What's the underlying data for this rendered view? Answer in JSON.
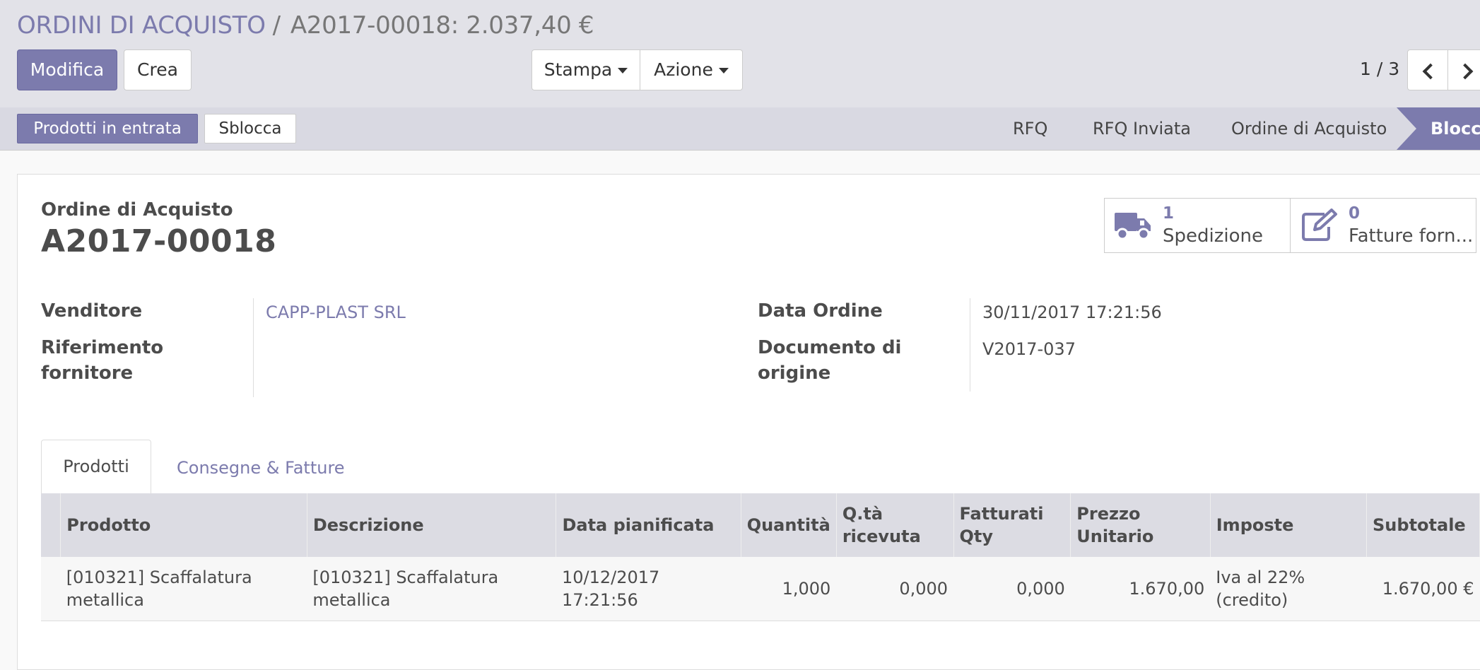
{
  "breadcrumb": {
    "parent": "ORDINI DI ACQUISTO",
    "separator": "/",
    "current": "A2017-00018: 2.037,40 €"
  },
  "toolbar": {
    "edit": "Modifica",
    "create": "Crea",
    "print": "Stampa",
    "action": "Azione"
  },
  "pager": {
    "value": "1 / 3"
  },
  "statusbar": {
    "buttons": {
      "incoming": "Prodotti in entrata",
      "unlock": "Sblocca"
    },
    "stages": [
      "RFQ",
      "RFQ Inviata",
      "Ordine di Acquisto"
    ],
    "active": "Blocca"
  },
  "form": {
    "doc_type": "Ordine di Acquisto",
    "doc_number": "A2017-00018",
    "fields": {
      "vendor_label": "Venditore",
      "vendor_value": "CAPP-PLAST SRL",
      "ref_label_1": "Riferimento",
      "ref_label_2": "fornitore",
      "date_label": "Data Ordine",
      "date_value": "30/11/2017 17:21:56",
      "origin_label_1": "Documento di",
      "origin_label_2": "origine",
      "origin_value": "V2017-037"
    },
    "smart_buttons": [
      {
        "count": "1",
        "label": "Spedizione"
      },
      {
        "count": "0",
        "label": "Fatture forn..."
      }
    ],
    "tabs": [
      "Prodotti",
      "Consegne & Fatture"
    ]
  },
  "table": {
    "headers": [
      [
        "Prodotto"
      ],
      [
        "Descrizione"
      ],
      [
        "Data pianificata"
      ],
      [
        "Quantità"
      ],
      [
        "Q.tà",
        "ricevuta"
      ],
      [
        "Fatturati",
        "Qty"
      ],
      [
        "Prezzo",
        "Unitario"
      ],
      [
        "Imposte"
      ],
      [
        "Subtotale"
      ]
    ],
    "rows": [
      {
        "product": [
          "[010321] Scaffalatura",
          "metallica"
        ],
        "description": [
          "[010321] Scaffalatura",
          "metallica"
        ],
        "date": [
          "10/12/2017",
          "17:21:56"
        ],
        "qty": "1,000",
        "received": "0,000",
        "invoiced": "0,000",
        "price": "1.670,00",
        "taxes": [
          "Iva al 22%",
          "(credito)"
        ],
        "subtotal": "1.670,00 €"
      }
    ]
  },
  "colors": {
    "primary": "#7c7bad",
    "control_bg": "#e2e2e8",
    "statusbar_bg": "#d9d9e2",
    "table_header": "#dcdce3"
  },
  "icons": {
    "truck": "truck-icon",
    "invoice": "edit-icon",
    "prev": "chevron-left-icon",
    "next": "chevron-right-icon"
  }
}
